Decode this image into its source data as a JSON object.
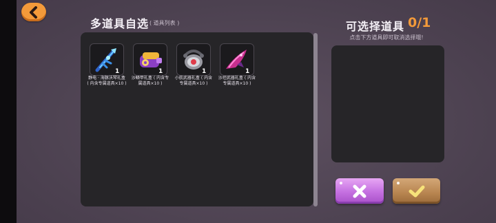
{
  "header": {
    "back_icon": "chevron-left-icon",
    "title": "多道具自选",
    "subtitle": "( 道具列表 )"
  },
  "items": [
    {
      "name": "静电 · 海豚沃琴礼盒\n( 内含专属道具×10 )",
      "count": "1",
      "icon": "blue-trident-weapon-icon"
    },
    {
      "name": "沙鳞甲礼盒 ( 内含专\n属道具×10 )",
      "count": "1",
      "icon": "purple-cannon-weapon-icon"
    },
    {
      "name": "小航武器礼盒 ( 内含\n专属道具×10 )",
      "count": "1",
      "icon": "robot-orb-weapon-icon"
    },
    {
      "name": "沙坦武器礼盒 ( 内含\n专属道具×10 )",
      "count": "1",
      "icon": "pink-blade-weapon-icon"
    }
  ],
  "selection": {
    "title": "可选择道具",
    "count": "0/1",
    "hint": "点击下方道具即可取消选择哦!"
  },
  "buttons": {
    "cancel_icon": "close-icon",
    "confirm_icon": "checkmark-icon"
  },
  "colors": {
    "accent": "#f39a3a",
    "cancel": "#c46fe0",
    "confirm": "#b7844f",
    "panel": "#262528"
  }
}
